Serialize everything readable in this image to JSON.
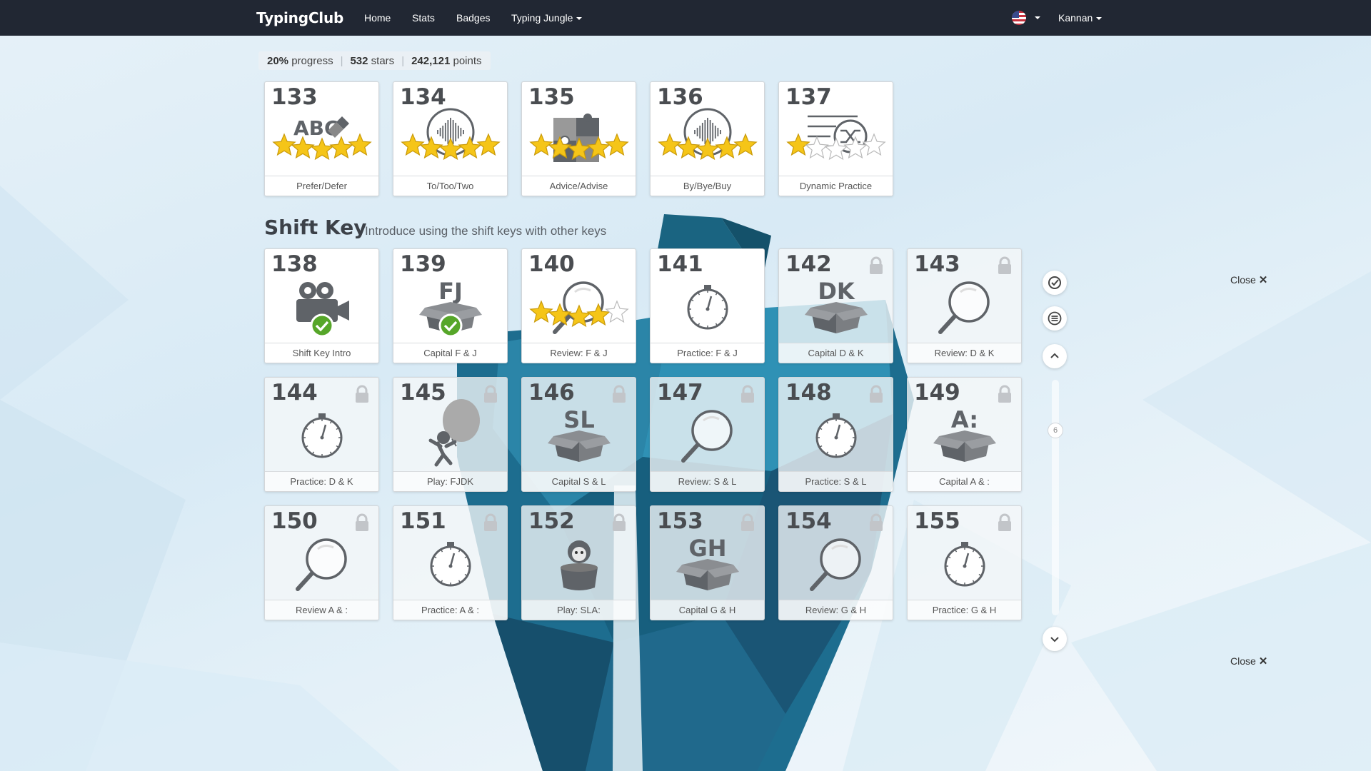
{
  "nav": {
    "brand": "TypingClub",
    "links": [
      "Home",
      "Stats",
      "Badges",
      "Typing Jungle"
    ],
    "user": "Kannan"
  },
  "stats": {
    "progress": "20%",
    "progress_label": "progress",
    "stars": "532",
    "stars_label": "stars",
    "points": "242,121",
    "points_label": "points"
  },
  "section": {
    "title": "Shift Key",
    "subtitle": "Introduce using the shift keys with other keys"
  },
  "lessons_prev": [
    {
      "num": "133",
      "label": "Prefer/Defer",
      "stars": 5,
      "icon": "abc-edit-icon"
    },
    {
      "num": "134",
      "label": "To/Too/Two",
      "stars": 5,
      "icon": "audio-wave-icon"
    },
    {
      "num": "135",
      "label": "Advice/Advise",
      "stars": 5,
      "icon": "puzzle-icon"
    },
    {
      "num": "136",
      "label": "By/Bye/Buy",
      "stars": 5,
      "icon": "audio-wave-icon"
    },
    {
      "num": "137",
      "label": "Dynamic Practice",
      "stars": 1,
      "icon": "shuffle-icon"
    }
  ],
  "lessons": [
    {
      "num": "138",
      "label": "Shift Key Intro",
      "icon": "video-camera-icon",
      "status": "done"
    },
    {
      "num": "139",
      "label": "Capital F & J",
      "icon": "box-icon",
      "letters": "FJ",
      "status": "done"
    },
    {
      "num": "140",
      "label": "Review: F & J",
      "icon": "magnifier-icon",
      "status": "stars",
      "stars": 4
    },
    {
      "num": "141",
      "label": "Practice: F & J",
      "icon": "stopwatch-icon",
      "status": "open"
    },
    {
      "num": "142",
      "label": "Capital D & K",
      "icon": "box-icon",
      "letters": "DK",
      "status": "locked"
    },
    {
      "num": "143",
      "label": "Review: D & K",
      "icon": "magnifier-icon",
      "status": "locked"
    },
    {
      "num": "144",
      "label": "Practice: D & K",
      "icon": "stopwatch-icon",
      "status": "locked"
    },
    {
      "num": "145",
      "label": "Play: FJDK",
      "icon": "balloon-game-icon",
      "status": "locked"
    },
    {
      "num": "146",
      "label": "Capital S & L",
      "icon": "box-icon",
      "letters": "SL",
      "status": "locked"
    },
    {
      "num": "147",
      "label": "Review: S & L",
      "icon": "magnifier-icon",
      "status": "locked"
    },
    {
      "num": "148",
      "label": "Practice: S & L",
      "icon": "stopwatch-icon",
      "status": "locked"
    },
    {
      "num": "149",
      "label": "Capital A & :",
      "icon": "box-icon",
      "letters": "A:",
      "status": "locked"
    },
    {
      "num": "150",
      "label": "Review A & :",
      "icon": "magnifier-icon",
      "status": "locked"
    },
    {
      "num": "151",
      "label": "Practice: A & :",
      "icon": "stopwatch-icon",
      "status": "locked"
    },
    {
      "num": "152",
      "label": "Play: SLA:",
      "icon": "pot-game-icon",
      "status": "locked"
    },
    {
      "num": "153",
      "label": "Capital G & H",
      "icon": "box-icon",
      "letters": "GH",
      "status": "locked"
    },
    {
      "num": "154",
      "label": "Review: G & H",
      "icon": "magnifier-icon",
      "status": "locked"
    },
    {
      "num": "155",
      "label": "Practice: G & H",
      "icon": "stopwatch-icon",
      "status": "locked"
    }
  ],
  "side": {
    "count": "6",
    "close_label": "Close"
  },
  "colors": {
    "navbar": "#212733",
    "star": "#f5c518",
    "check": "#56a629"
  }
}
